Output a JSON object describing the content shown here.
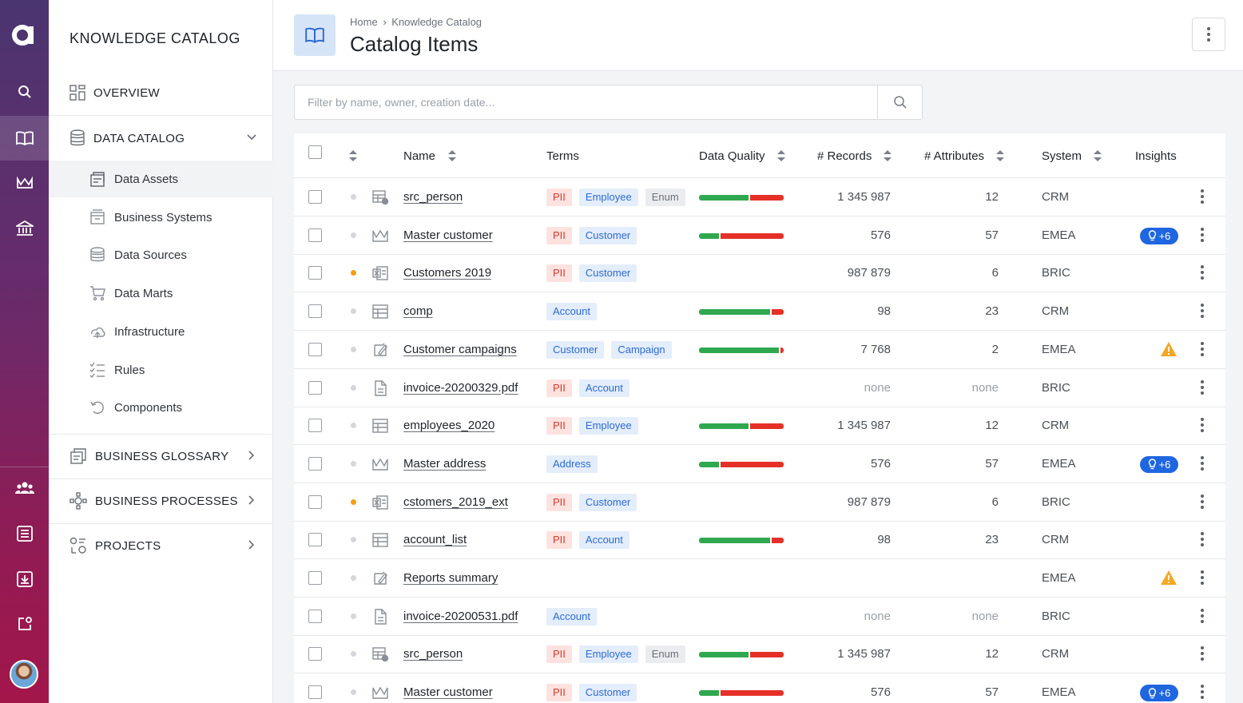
{
  "app": {
    "logo": "a",
    "rail_icons": [
      "search-icon",
      "book-icon",
      "crown-icon",
      "bank-icon",
      "team-icon",
      "list-icon",
      "import-icon",
      "external-icon"
    ]
  },
  "nav": {
    "title": "KNOWLEDGE CATALOG",
    "overview": "OVERVIEW",
    "data_catalog": "DATA CATALOG",
    "sub": [
      "Data Assets",
      "Business Systems",
      "Data Sources",
      "Data Marts",
      "Infrastructure",
      "Rules",
      "Components"
    ],
    "business_glossary": "BUSINESS GLOSSARY",
    "business_processes": "BUSINESS PROCESSES",
    "projects": "PROJECTS"
  },
  "header": {
    "crumb_home": "Home",
    "crumb_current": "Knowledge Catalog",
    "title": "Catalog Items"
  },
  "search": {
    "placeholder": "Filter by name, owner, creation date..."
  },
  "table": {
    "columns": {
      "name": "Name",
      "terms": "Terms",
      "quality": "Data Quality",
      "records": "# Records",
      "attributes": "# Attributes",
      "system": "System",
      "insights": "Insights"
    },
    "rows": [
      {
        "name": "src_person",
        "icon": "table-user-icon",
        "dot": "gray",
        "terms": [
          [
            "PII",
            "pii"
          ],
          [
            "Employee",
            "blue"
          ],
          [
            "Enum",
            "gray"
          ]
        ],
        "quality": 0.6,
        "records": "1 345 987",
        "attributes": "12",
        "system": "CRM",
        "insight": "none"
      },
      {
        "name": "Master customer",
        "icon": "crown-icon",
        "dot": "gray",
        "terms": [
          [
            "PII",
            "pii"
          ],
          [
            "Customer",
            "blue"
          ]
        ],
        "quality": 0.24,
        "records": "576",
        "attributes": "57",
        "system": "EMEA",
        "insight": "pill",
        "pill_text": "+6"
      },
      {
        "name": "Customers 2019",
        "icon": "excel-icon",
        "dot": "orange",
        "terms": [
          [
            "PII",
            "pii"
          ],
          [
            "Customer",
            "blue"
          ]
        ],
        "quality": null,
        "records": "987 879",
        "attributes": "6",
        "system": "BRIC",
        "insight": "none"
      },
      {
        "name": "comp",
        "icon": "table-icon",
        "dot": "gray",
        "terms": [
          [
            "Account",
            "blue"
          ]
        ],
        "quality": 0.86,
        "records": "98",
        "attributes": "23",
        "system": "CRM",
        "insight": "none"
      },
      {
        "name": "Customer campaigns",
        "icon": "report-icon",
        "dot": "gray",
        "terms": [
          [
            "Customer",
            "blue"
          ],
          [
            "Campaign",
            "blue"
          ]
        ],
        "quality": 0.96,
        "records": "7 768",
        "attributes": "2",
        "system": "EMEA",
        "insight": "warning"
      },
      {
        "name": "invoice-20200329.pdf",
        "icon": "document-icon",
        "dot": "gray",
        "terms": [
          [
            "PII",
            "pii"
          ],
          [
            "Account",
            "blue"
          ]
        ],
        "quality": null,
        "records": "none",
        "attributes": "none",
        "system": "BRIC",
        "insight": "none"
      },
      {
        "name": "employees_2020",
        "icon": "table-icon",
        "dot": "gray",
        "terms": [
          [
            "PII",
            "pii"
          ],
          [
            "Employee",
            "blue"
          ]
        ],
        "quality": 0.6,
        "records": "1 345 987",
        "attributes": "12",
        "system": "CRM",
        "insight": "none"
      },
      {
        "name": "Master address",
        "icon": "crown-icon",
        "dot": "gray",
        "terms": [
          [
            "Address",
            "blue"
          ]
        ],
        "quality": 0.24,
        "records": "576",
        "attributes": "57",
        "system": "EMEA",
        "insight": "pill",
        "pill_text": "+6"
      },
      {
        "name": "cstomers_2019_ext",
        "icon": "excel-icon",
        "dot": "orange",
        "terms": [
          [
            "PII",
            "pii"
          ],
          [
            "Customer",
            "blue"
          ]
        ],
        "quality": null,
        "records": "987 879",
        "attributes": "6",
        "system": "BRIC",
        "insight": "none"
      },
      {
        "name": "account_list",
        "icon": "table-icon",
        "dot": "gray",
        "terms": [
          [
            "PII",
            "pii"
          ],
          [
            "Account",
            "blue"
          ]
        ],
        "quality": 0.86,
        "records": "98",
        "attributes": "23",
        "system": "CRM",
        "insight": "none"
      },
      {
        "name": "Reports summary",
        "icon": "report-icon",
        "dot": "gray",
        "terms": [],
        "quality": null,
        "records": "",
        "attributes": "",
        "system": "EMEA",
        "insight": "warning"
      },
      {
        "name": "invoice-20200531.pdf",
        "icon": "document-icon",
        "dot": "gray",
        "terms": [
          [
            "Account",
            "blue"
          ]
        ],
        "quality": null,
        "records": "none",
        "attributes": "none",
        "system": "BRIC",
        "insight": "none"
      },
      {
        "name": "src_person",
        "icon": "table-user-icon",
        "dot": "gray",
        "terms": [
          [
            "PII",
            "pii"
          ],
          [
            "Employee",
            "blue"
          ],
          [
            "Enum",
            "gray"
          ]
        ],
        "quality": 0.6,
        "records": "1 345 987",
        "attributes": "12",
        "system": "CRM",
        "insight": "none"
      },
      {
        "name": "Master customer",
        "icon": "crown-icon",
        "dot": "gray",
        "terms": [
          [
            "PII",
            "pii"
          ],
          [
            "Customer",
            "blue"
          ]
        ],
        "quality": 0.24,
        "records": "576",
        "attributes": "57",
        "system": "EMEA",
        "insight": "pill",
        "pill_text": "+6"
      }
    ]
  },
  "colors": {
    "accent_blue": "#1f66e0",
    "quality_good": "#2fa84f",
    "quality_bad": "#e53027",
    "warning": "#f5a623",
    "pending_dot": "#f59e0b"
  }
}
